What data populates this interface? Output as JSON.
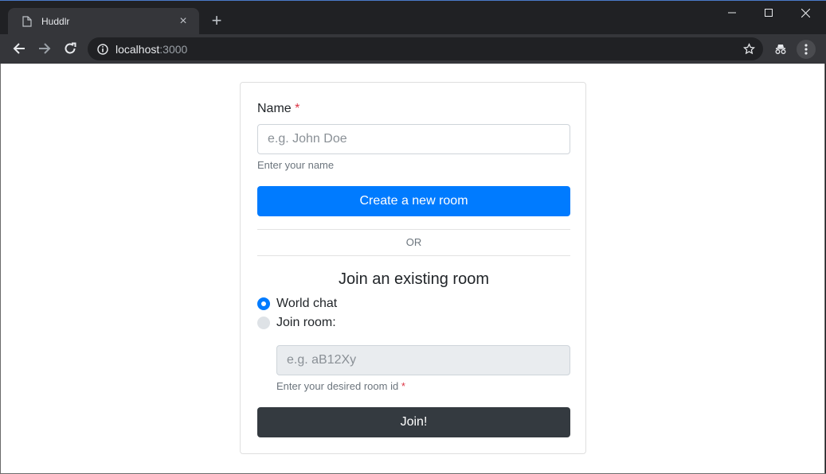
{
  "browser": {
    "tab_title": "Huddlr",
    "url_host": "localhost",
    "url_port": ":3000"
  },
  "form": {
    "name_label": "Name",
    "required_mark": "*",
    "name_placeholder": "e.g. John Doe",
    "name_help": "Enter your name",
    "create_button": "Create a new room",
    "divider_text": "OR",
    "join_heading": "Join an existing room",
    "radio_world": "World chat",
    "radio_join": "Join room:",
    "room_placeholder": "e.g. aB12Xy",
    "room_help": "Enter your desired room id",
    "join_button": "Join!"
  },
  "colors": {
    "primary": "#007bff",
    "dark": "#343a40",
    "required": "#dc3545"
  }
}
